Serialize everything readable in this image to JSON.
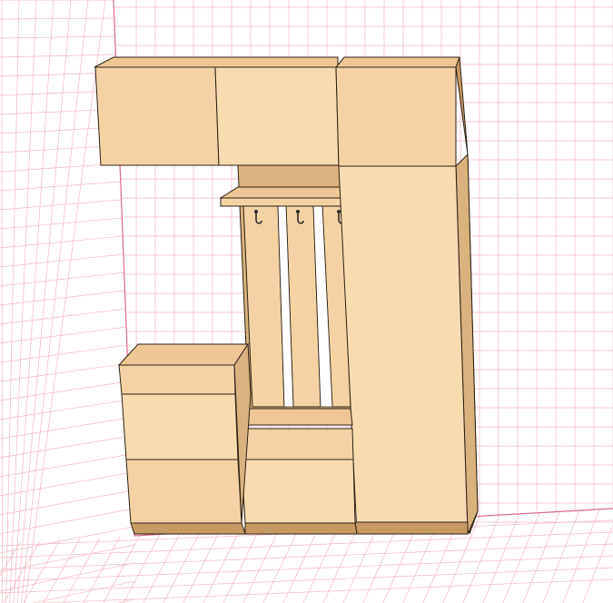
{
  "scene": {
    "colors": {
      "background": "#ffffff",
      "grid_line": "#f4b8c4",
      "wall_edge": "#e06a86",
      "wood_front": "#f3d3a4",
      "wood_light": "#f7dcb2",
      "wood_top": "#edc794",
      "wood_side": "#d9b37d",
      "wood_dark": "#c69a63",
      "outline": "#2b2116",
      "hook": "#2a2a2a"
    },
    "icons": {
      "hook": "coat-hook-icon"
    },
    "furniture": {
      "upper_cabinets": 2,
      "wardrobe_doors": 2,
      "chest_drawers": 3,
      "bench_drawers": 2,
      "hanger_panels": 3,
      "hooks": 3
    }
  }
}
